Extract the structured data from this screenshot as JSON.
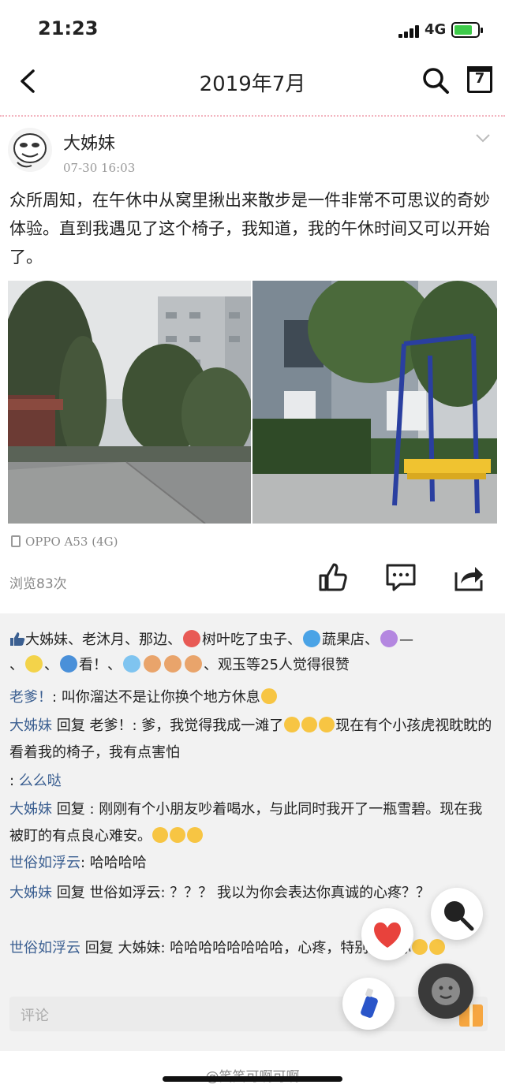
{
  "status_bar": {
    "time": "21:23",
    "network": "4G"
  },
  "nav": {
    "title": "2019年7月",
    "calendar_day": "7"
  },
  "post": {
    "author": "大姊妹",
    "time": "07-30 16:03",
    "text": "众所周知，在午休中从窝里揪出来散步是一件非常不可思议的奇妙体验。直到我遇见了这个椅子，我知道，我的午休时间又可以开始了。",
    "device": "OPPO A53 (4G)",
    "views": "浏览83次"
  },
  "likes": {
    "names_1": "大姊妹、老沐月、那边、",
    "names_2": "树叶吃了虫子、",
    "names_3": "蔬果店、",
    "names_4": "—",
    "names_5": "、",
    "names_6": "、",
    "names_7": "看！、",
    "names_8": "、观玉等25人觉得很赞"
  },
  "comments": [
    {
      "name": "老爹！",
      "text": ": 叫你溜达不是让你换个地方休息"
    },
    {
      "name": "大姊妹",
      "text": " 回复 老爹！: 爹，我觉得我成一滩了",
      "text2": "现在有个小孩虎视眈眈的看着我的椅子，我有点害怕"
    },
    {
      "name": "",
      "text": ": ",
      "name2": "么么哒"
    },
    {
      "name": "大姊妹",
      "text": " 回复 : 刚刚有个小朋友吵着喝水，与此同时我开了一瓶雪碧。现在我被盯的有点良心难安。"
    },
    {
      "name": "世俗如浮云",
      "text": ": 哈哈哈哈"
    },
    {
      "name": "大姊妹",
      "text": " 回复 世俗如浮云: ？？？ 我以为你会表达你真诚的心疼？？"
    },
    {
      "name": "世俗如浮云",
      "text": " 回复 大姊妹: 哈哈哈哈哈哈哈哈，心疼，特别心疼你"
    }
  ],
  "comment_input": {
    "placeholder": "评论"
  },
  "watermark": "@笑笑可啊可啊"
}
